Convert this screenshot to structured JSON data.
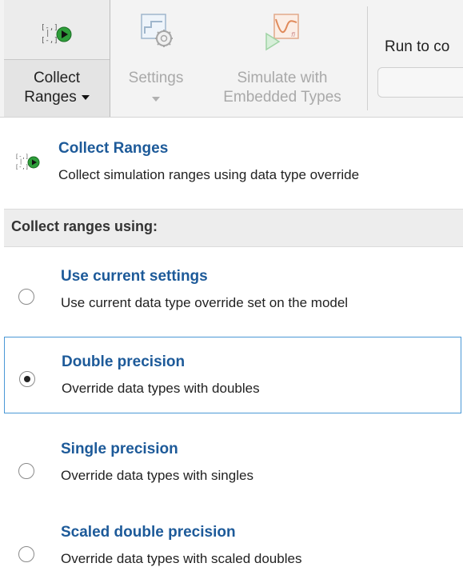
{
  "toolstrip": {
    "collect_label_line1": "Collect",
    "collect_label_line2": "Ranges",
    "settings_label": "Settings",
    "simulate_label_line1": "Simulate with",
    "simulate_label_line2": "Embedded Types",
    "run_to_label": "Run to co"
  },
  "menu": {
    "header_item": {
      "title": "Collect Ranges",
      "description": "Collect simulation ranges using data type override"
    },
    "section_label": "Collect ranges using:",
    "options": [
      {
        "title": "Use current settings",
        "description": "Use current data type override set on the model",
        "selected": false
      },
      {
        "title": "Double precision",
        "description": "Override data types with doubles",
        "selected": true
      },
      {
        "title": "Single precision",
        "description": "Override data types with singles",
        "selected": false
      },
      {
        "title": "Scaled double precision",
        "description": "Override data types with scaled doubles",
        "selected": false
      }
    ]
  },
  "colors": {
    "accent_title": "#1d5a99",
    "selection_border": "#4a98d6",
    "play_green": "#2e9e3a"
  },
  "icons": {
    "collect": "collect-ranges-icon",
    "settings": "settings-gear-icon",
    "simulate": "simulate-embedded-types-icon"
  }
}
